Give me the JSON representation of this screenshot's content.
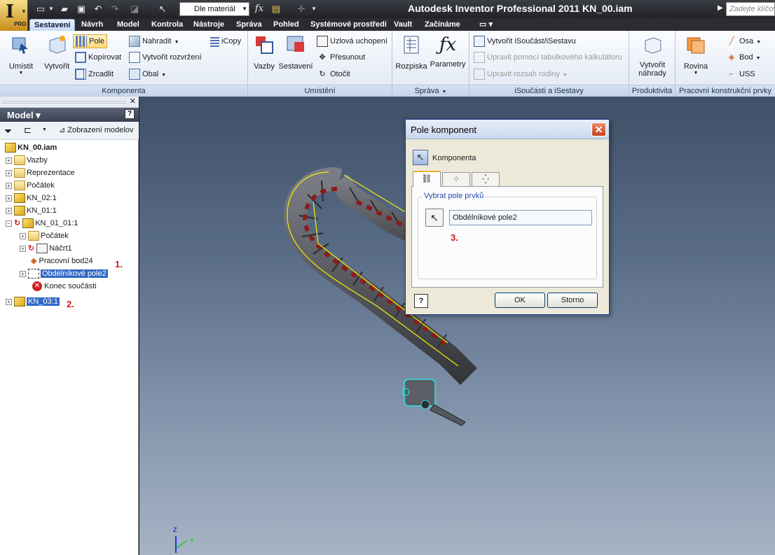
{
  "titlebar": {
    "material": "Dle materiál",
    "title": "Autodesk Inventor Professional 2011    KN_00.iam",
    "help_placeholder": "Zadejte klíčov",
    "app_logo": "I",
    "pro_label": "PRO",
    "icons": {
      "new": "new-file-icon",
      "open": "open-file-icon",
      "save": "save-icon",
      "undo": "undo-icon",
      "redo": "redo-icon",
      "fx": "fx",
      "color": "color-icon"
    }
  },
  "tabs": [
    "Sestavení",
    "Návrh",
    "Model",
    "Kontrola",
    "Nástroje",
    "Správa",
    "Pohled",
    "Systémové prostředí",
    "Vault",
    "Začínáme"
  ],
  "ribbon": {
    "komponenta": {
      "title": "Komponenta",
      "umistit": "Umístit",
      "vytvorit": "Vytvořit",
      "pole": "Pole",
      "kopirovat": "Kopírovat",
      "zrcadlit": "Zrcadlit",
      "nahradit": "Nahradit",
      "vytvorit_rozvrzeni": "Vytvořit rozvržení",
      "obal": "Obal",
      "icopy": "iCopy"
    },
    "umisteni": {
      "title": "Umístění",
      "vazby": "Vazby",
      "sestaveni": "Sestavení",
      "uzlova": "Uzlová uchopení",
      "presunout": "Přesunout",
      "otocit": "Otočit"
    },
    "sprava": {
      "title": "Správa",
      "rozpiska": "Rozpiska",
      "parametry": "Parametry"
    },
    "isoucasti": {
      "title": "iSoučásti a iSestavy",
      "vytvorit": "Vytvořit iSoučást/iSestavu",
      "upravit_tab": "Upravit pomocí tabulkového kalkulátoru",
      "upravit_rozsah": "Upravit rozsah rodiny"
    },
    "produktivita": {
      "title": "Produktivita",
      "vytvorit_nahrady": "Vytvořit náhrady"
    },
    "pracovni": {
      "title": "Pracovní konstrukční prvky",
      "rovina": "Rovina",
      "osa": "Osa",
      "bod": "Bod",
      "uss": "USS"
    }
  },
  "browser": {
    "title": "Model",
    "view_label": "Zobrazení modelov",
    "tree": [
      {
        "label": "KN_00.iam"
      },
      {
        "label": "Vazby"
      },
      {
        "label": "Reprezentace"
      },
      {
        "label": "Počátek"
      },
      {
        "label": "KN_02:1"
      },
      {
        "label": "KN_01:1"
      },
      {
        "label": "KN_01_01:1"
      },
      {
        "label": "Počátek"
      },
      {
        "label": "Náčrt1"
      },
      {
        "label": "Pracovní bod24"
      },
      {
        "label": "Obdélníkové pole2"
      },
      {
        "label": "Konec součásti"
      },
      {
        "label": "KN_03:1"
      }
    ],
    "annotations": [
      "1.",
      "2."
    ]
  },
  "dialog": {
    "title": "Pole komponent",
    "component_label": "Komponenta",
    "group_label": "Vybrat pole prvků",
    "field_value": "Obdélníkové pole2",
    "annotation": "3.",
    "ok": "OK",
    "cancel": "Storno",
    "help": "?"
  },
  "triad": {
    "z": "Z",
    "y": "Y"
  },
  "colors": {
    "selection": "#3168c5",
    "annotation": "#d01818",
    "highlight_yellow": "#f2f000",
    "chain_red": "#8a1c1c",
    "chain_gray": "#4e5157",
    "cyan_highlight": "#35e0e8"
  }
}
